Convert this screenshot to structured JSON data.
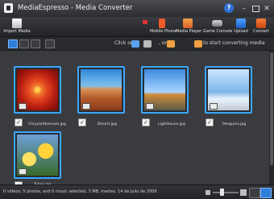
{
  "window": {
    "title": "MediaEspresso - Media Converter"
  },
  "toolbar": {
    "import_label": "Import Media",
    "mobile_label": "Mobile Phone",
    "media_label": "Media Player",
    "game_label": "Game Console",
    "upload_label": "Upload",
    "convert_label": "Convert"
  },
  "hint": {
    "part1": "Click on",
    "part2": ", or",
    "part3": "to start converting media"
  },
  "gallery": {
    "items": [
      {
        "name": "Chrysanthemum.jpg",
        "checked": true
      },
      {
        "name": "Desert.jpg",
        "checked": true
      },
      {
        "name": "Lighthouse.jpg",
        "checked": true
      },
      {
        "name": "Penguins.jpg",
        "checked": true
      },
      {
        "name": "Tulips.jpg",
        "checked": true
      }
    ]
  },
  "status": {
    "text": "0 videos, 5 photos, and 0 music selected, 3 MB, martes, 14 de julio de 2009"
  },
  "icons": [
    "app-icon",
    "help-icon",
    "import-media-icon",
    "mobile-phone-icon",
    "media-player-icon",
    "game-console-icon",
    "upload-icon",
    "convert-icon",
    "photo-badge-icon",
    "checkbox-icon",
    "zoom-slider"
  ],
  "colors": {
    "accent": "#3aa7ff",
    "background": "#3a3b3f",
    "toolbar": "#2c2d31"
  }
}
